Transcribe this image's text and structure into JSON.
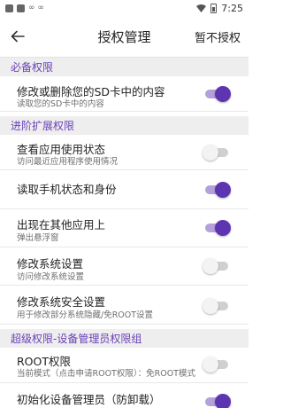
{
  "status_bar": {
    "time": "7:25",
    "icons": [
      "notification-square-icon",
      "notification-square-icon",
      "infinity-icon",
      "infinity-icon",
      "wifi-icon",
      "battery-charging-icon"
    ]
  },
  "app_bar": {
    "title": "授权管理",
    "action_label": "暂不授权",
    "back_icon": "arrow-back-icon"
  },
  "colors": {
    "accent": "#5e35b1",
    "accent_track": "#b5a0dc",
    "section_text": "#6a3fb8",
    "section_bg": "#eeeeee"
  },
  "sections": [
    {
      "title": "必备权限",
      "items": [
        {
          "title": "修改或删除您的SD卡中的内容",
          "subtitle": "读取您的SD卡中的内容",
          "enabled": true
        }
      ]
    },
    {
      "title": "进阶扩展权限",
      "items": [
        {
          "title": "查看应用使用状态",
          "subtitle": "访问最近应用程序使用情况",
          "enabled": false
        },
        {
          "title": "读取手机状态和身份",
          "subtitle": "",
          "enabled": true
        },
        {
          "title": "出现在其他应用上",
          "subtitle": "弹出悬浮窗",
          "enabled": true
        },
        {
          "title": "修改系统设置",
          "subtitle": "访问修改系统设置",
          "enabled": false
        },
        {
          "title": "修改系统安全设置",
          "subtitle": "用于修改部分系统隐藏/免ROOT设置",
          "enabled": false
        }
      ]
    },
    {
      "title": "超级权限-设备管理员权限组",
      "items": [
        {
          "title": "ROOT权限",
          "subtitle": "当前模式（点击申请ROOT权限）：免ROOT模式",
          "enabled": false
        },
        {
          "title": "初始化设备管理员（防卸载）",
          "subtitle": "",
          "enabled": true
        }
      ]
    }
  ]
}
